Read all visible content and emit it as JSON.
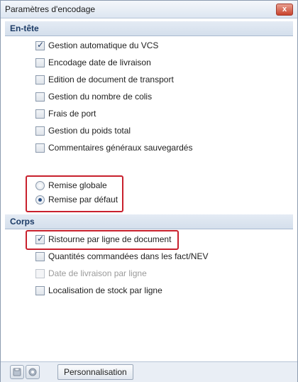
{
  "window": {
    "title": "Paramètres d'encodage",
    "close_label": "x"
  },
  "header_section": {
    "title": "En-tête",
    "options": [
      {
        "label": "Gestion automatique du VCS",
        "checked": true
      },
      {
        "label": "Encodage date de livraison",
        "checked": false
      },
      {
        "label": "Edition de document de transport",
        "checked": false
      },
      {
        "label": "Gestion du nombre de colis",
        "checked": false
      },
      {
        "label": "Frais de port",
        "checked": false
      },
      {
        "label": "Gestion du poids total",
        "checked": false
      },
      {
        "label": "Commentaires généraux sauvegardés",
        "checked": false
      }
    ],
    "radios": [
      {
        "label": "Remise globale",
        "selected": false
      },
      {
        "label": "Remise par défaut",
        "selected": true
      }
    ]
  },
  "body_section": {
    "title": "Corps",
    "options": [
      {
        "label": "Ristourne par ligne de document",
        "checked": true,
        "disabled": false
      },
      {
        "label": "Quantités commandées dans les fact/NEV",
        "checked": false,
        "disabled": false
      },
      {
        "label": "Date de livraison par ligne",
        "checked": false,
        "disabled": true
      },
      {
        "label": "Localisation de stock par ligne",
        "checked": false,
        "disabled": false
      }
    ]
  },
  "bottom_bar": {
    "icons": [
      "save-icon",
      "refresh-icon"
    ],
    "personalize_label": "Personnalisation"
  },
  "colors": {
    "highlight": "#c8202d",
    "section_title": "#1c3b66"
  }
}
